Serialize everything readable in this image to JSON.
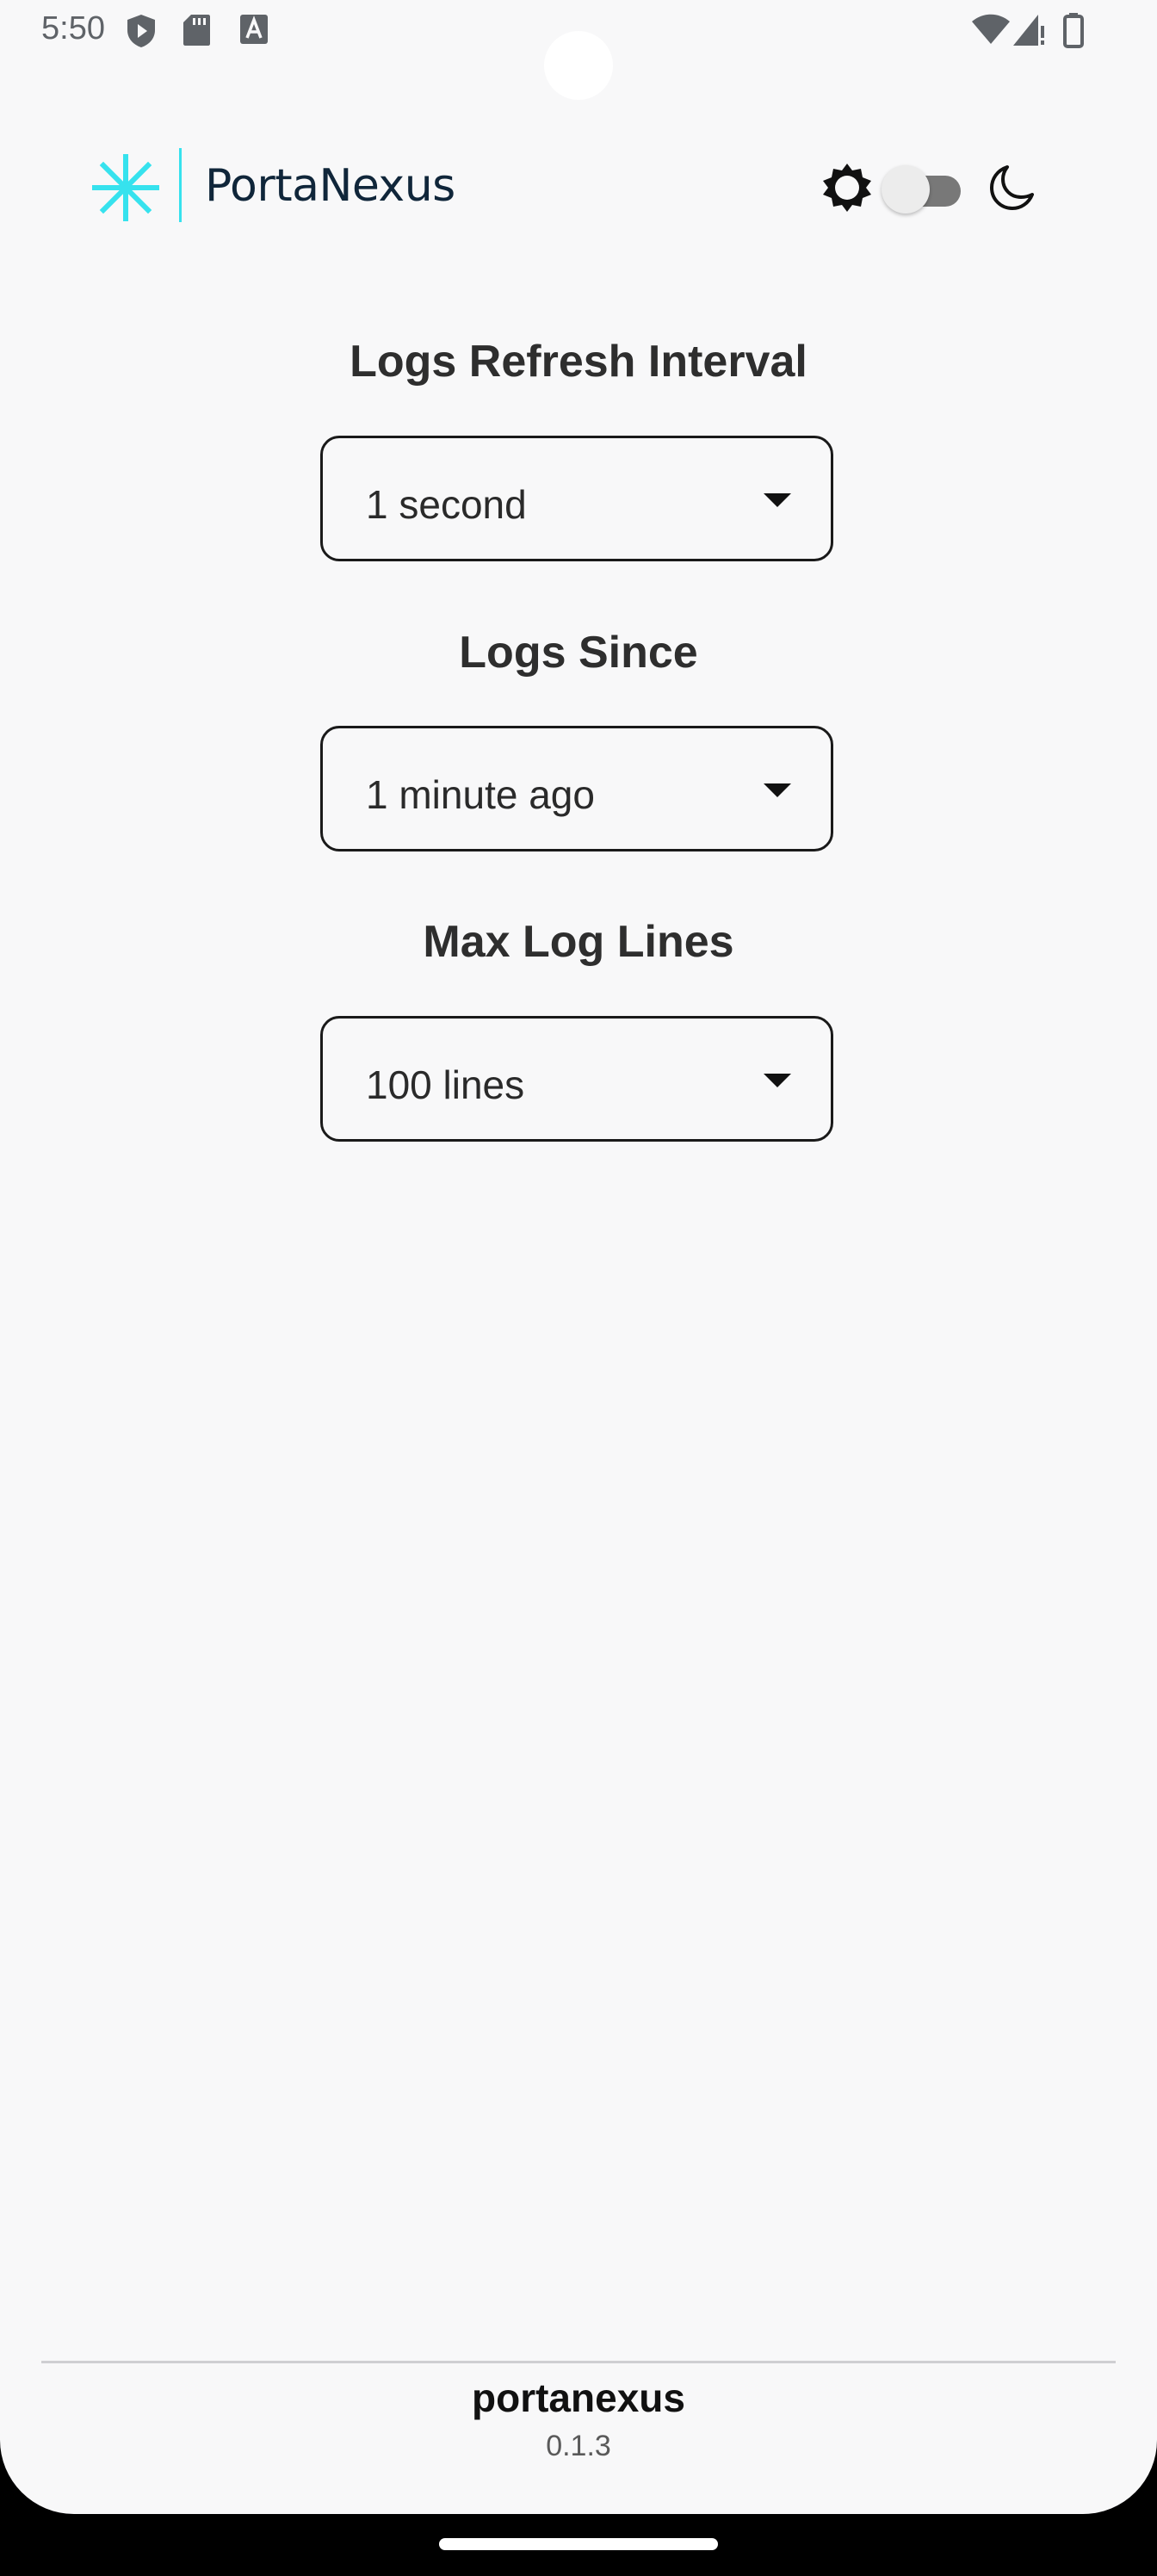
{
  "status_bar": {
    "time": "5:50",
    "left_icons": [
      "shield-play-icon",
      "sd-card-icon",
      "font-icon"
    ],
    "right_icons": [
      "wifi-icon",
      "cell-signal-icon",
      "battery-icon"
    ]
  },
  "header": {
    "app_name": "PortaNexus",
    "logo_icon": "asterisk-logo-icon",
    "theme_toggle": {
      "light_icon": "sun-icon",
      "dark_icon": "moon-icon",
      "dark_mode": false
    }
  },
  "settings": {
    "refresh_interval": {
      "title": "Logs Refresh Interval",
      "value": "1 second"
    },
    "logs_since": {
      "title": "Logs Since",
      "value": "1 minute ago"
    },
    "max_log_lines": {
      "title": "Max Log Lines",
      "value": "100 lines"
    }
  },
  "footer": {
    "name": "portanexus",
    "version": "0.1.3"
  },
  "colors": {
    "accent": "#36e2ee",
    "background": "#f8f8f9",
    "text": "#2e2e2e"
  }
}
